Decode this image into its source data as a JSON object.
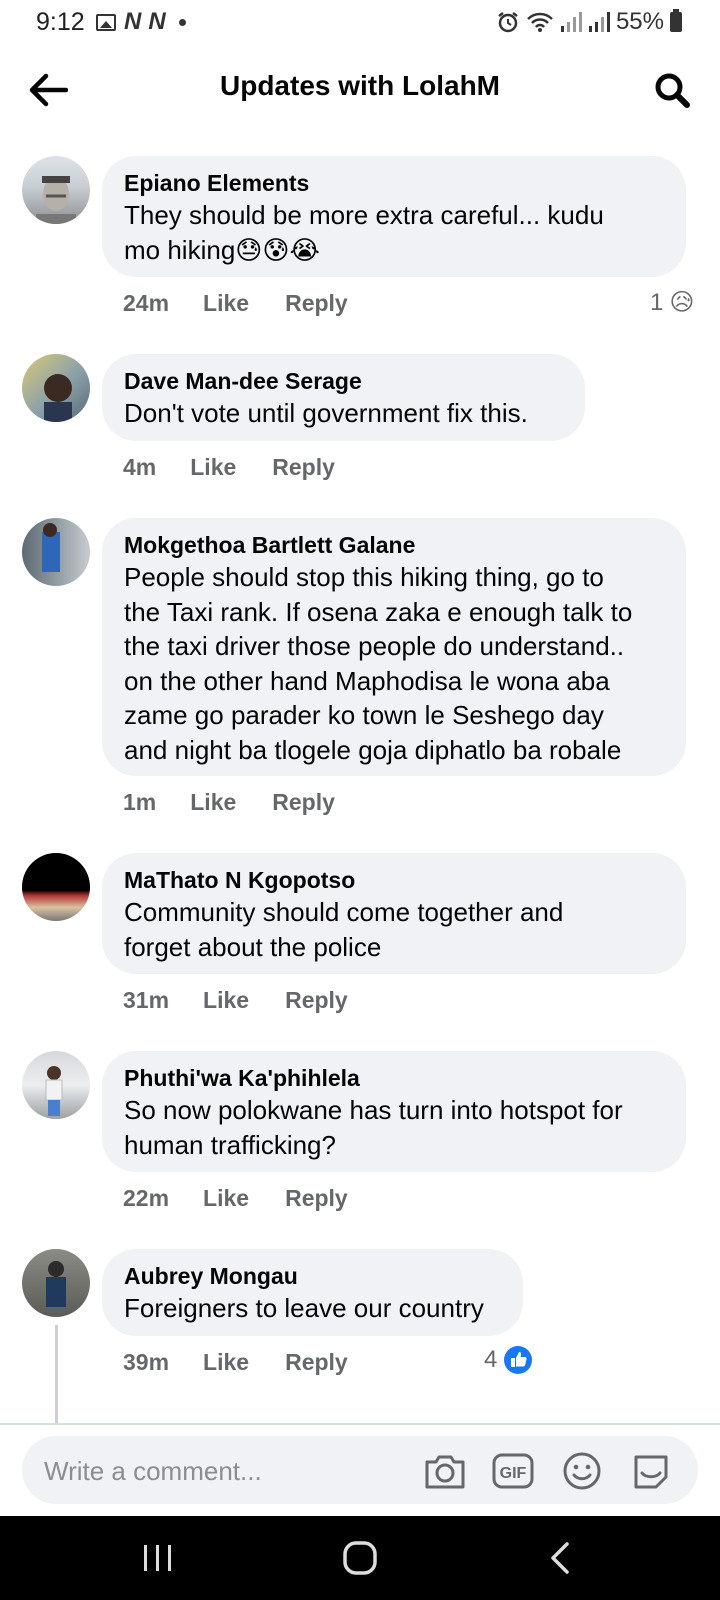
{
  "status_bar": {
    "time": "9:12",
    "battery": "55%",
    "notifications": [
      "N",
      "N"
    ]
  },
  "header": {
    "title": "Updates with LolahM",
    "back_icon": "arrow-left-icon",
    "search_icon": "search-icon"
  },
  "actions": {
    "like": "Like",
    "reply": "Reply"
  },
  "comments": [
    {
      "author": "Epiano Elements",
      "lines": [
        "They should be more extra careful... kudu",
        "mo hiking😓😰😭"
      ],
      "time": "24m",
      "reaction_count": "1",
      "reaction_emoji": "😥"
    },
    {
      "author": "Dave Man-dee Serage",
      "lines": [
        "Don't vote until government fix this."
      ],
      "time": "4m"
    },
    {
      "author": "Mokgethoa Bartlett Galane",
      "lines": [
        "People should stop this hiking thing, go to",
        "the Taxi rank. If osena zaka e enough talk to",
        "the taxi driver those people do understand..",
        "on the other hand Maphodisa  le wona aba",
        "zame go parader ko town le Seshego day",
        "and night ba tlogele goja diphatlo ba robale"
      ],
      "time": "1m"
    },
    {
      "author": "MaThato N Kgopotso",
      "lines": [
        "Community should come together and",
        "forget about the police"
      ],
      "time": "31m"
    },
    {
      "author": "Phuthi'wa Ka'phihlela",
      "lines": [
        "So now polokwane has turn into hotspot for",
        "human trafficking?"
      ],
      "time": "22m"
    },
    {
      "author": "Aubrey Mongau",
      "lines": [
        "Foreigners to leave our country"
      ],
      "time": "39m",
      "reaction_count": "4",
      "reaction_icon": "thumbs-up-icon"
    }
  ],
  "composer": {
    "placeholder": "Write a comment...",
    "icons": [
      "camera-icon",
      "gif-icon",
      "emoji-icon",
      "sticker-icon"
    ]
  },
  "colors": {
    "bubble": "#f0f2f5",
    "meta": "#65676b",
    "like_blue": "#1877f2"
  }
}
